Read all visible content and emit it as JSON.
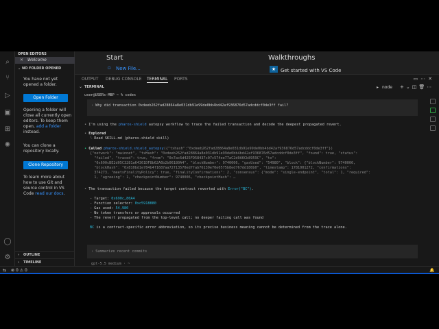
{
  "sidebar": {
    "open_editors": "OPEN EDITORS",
    "welcome_tab": "Welcome",
    "no_folder": "NO FOLDER OPENED",
    "not_opened": "You have not yet opened a folder.",
    "open_folder_btn": "Open Folder",
    "open_folder_text_1": "Opening a folder will close all currently open editors. To keep them open,",
    "add_folder_link": "add a folder",
    "open_folder_text_2": "instead.",
    "clone_text": "You can clone a repository locally.",
    "clone_btn": "Clone Repository",
    "learn_text_1": "To learn more about how to use Git and source control in VS Code",
    "docs_link": "read our docs",
    "learn_text_2": ".",
    "outline": "OUTLINE",
    "timeline": "TIMELINE"
  },
  "editor": {
    "start": "Start",
    "new_file": "New File...",
    "walkthroughs": "Walkthroughs",
    "get_started": "Get started with VS Code"
  },
  "panel": {
    "tabs": [
      "OUTPUT",
      "DEBUG CONSOLE",
      "TERMINAL",
      "PORTS"
    ],
    "terminal_label": "TERMINAL",
    "shell": "node"
  },
  "terminal": {
    "prompt": "user@USERs-MBP ~ % codex",
    "question": "Why did transaction 0xdeeb262fad28864a8e031db91e99de0bb4bd42af936876d57adcddcf0de3ff fail?",
    "using_1": "I'm using the ",
    "using_skill": "pharos-shield",
    "using_2": " autopsy workflow to trace the failed transaction and decode the deepest propagated revert.",
    "explored": "Explored",
    "read_skill": "Read SKILL.md (pharos-shield skill)",
    "called_label": "Called",
    "called_fn": "pharos-shield.shield_autopsy",
    "called_args": "({\"txhash\":\"0xdeeb262fad28864a8e031db91e99de0bb4bd42af936876d57adcddcf0de3ff\"})",
    "result_lines": [
      "{\"network\": \"mainnet\", \"txHash\": \"0xdeeb262fad28864a8e031db91e99de0bb4bd42af936876d57adcddcf0de3ff\", \"found\": true, \"status\":",
      "  \"failed\", \"traced\": true, \"from\": \"0x7ac6d425FD58437c07c574ee77aC2d0A6Cb8959C\", \"to\":",
      "  \"0x690cBE2d05C3281a64361DF8b62A6b2b06180A4\", \"blockNumber\": 9740006, \"gasUsed\": \"54980\", \"block\": {\"blockNumber\": 9740006,",
      "  \"blockHash\": \"0x810bd1e784b4f1687aa72f13570ed7fab76130e70e0575b8ed767dd180b0\", \"timestamp\": 1781001272, \"confirmations\":",
      "  374273, \"meetsFinalityPolicy\": true, \"finalityConfirmations\": 2, \"consensus\": {\"mode\": \"single-endpoint\", \"total\": 1, \"required\":",
      "  1, \"agreeing\": 1, \"checkpointNumber\": 9740006, \"checkpointHash\": …"
    ],
    "answer_1": "The transaction failed because the target contract reverted with ",
    "answer_err": "Error(\"BC\")",
    "answer_2": ".",
    "bullets": [
      {
        "label": "- Target: ",
        "value": "0x690c…80A4"
      },
      {
        "label": "- Function selector: ",
        "value": "0xc5918880"
      },
      {
        "label": "- Gas used: ",
        "value": "54,980"
      },
      {
        "label": "- No token transfers or approvals occurred",
        "value": ""
      },
      {
        "label": "- The revert propagated from the top-level call; no deeper failing call was found",
        "value": ""
      }
    ],
    "bc_code": "BC",
    "bc_text": " is a contract-specific error abbreviation, so its precise business meaning cannot be determined from the trace alone.",
    "input_placeholder": "Summarize recent commits",
    "model": "gpt-5.5 medium · ~"
  },
  "status": {
    "errors": "0",
    "warnings": "0"
  }
}
